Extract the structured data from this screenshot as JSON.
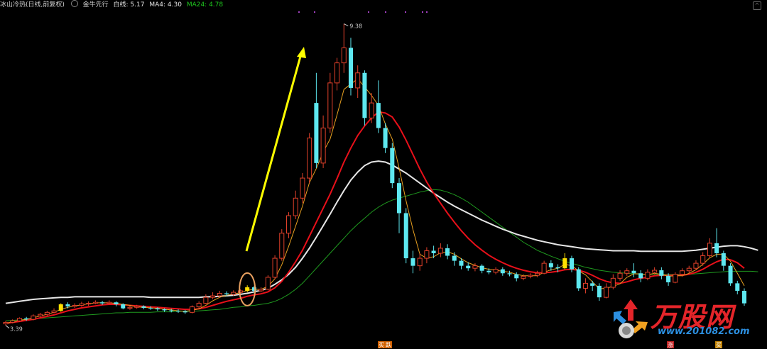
{
  "header": {
    "indicator_name": "冰山冷热(日线,前复权)",
    "study_name": "金牛先行",
    "white_label": "白线: 5.17",
    "ma4_label": "MA4: 4.30",
    "ma24_label": "MA24: 4.78",
    "icon": "gear-icon"
  },
  "watermark": {
    "brand": "万股网",
    "url": "www.201082.com"
  },
  "signals": {
    "buy_label": "买",
    "sell_label": "跌",
    "markers": [
      "买",
      "跌",
      "涨",
      "买"
    ]
  },
  "chart_data": {
    "type": "candlestick",
    "title": "",
    "price_high_label": "9.38",
    "price_low_label": "3.39",
    "ylim": [
      3.2,
      9.6
    ],
    "colors": {
      "up_candle": "#e0402a",
      "down_candle": "#5ee8f0",
      "highlight_candle": "#ffe000",
      "white_line": "#e6e6e6",
      "ma4_line": "#e8a020",
      "ma24_line": "#1f9a1f",
      "red_ma": "#e8101a",
      "arrow": "#ffff00",
      "circle": "#e8a060"
    },
    "candles": [
      [
        3.39,
        3.42,
        3.36,
        3.45
      ],
      [
        3.42,
        3.45,
        3.4,
        3.48
      ],
      [
        3.45,
        3.5,
        3.43,
        3.52
      ],
      [
        3.5,
        3.48,
        3.45,
        3.53
      ],
      [
        3.48,
        3.55,
        3.46,
        3.58
      ],
      [
        3.55,
        3.58,
        3.52,
        3.61
      ],
      [
        3.58,
        3.62,
        3.55,
        3.65
      ],
      [
        3.62,
        3.65,
        3.6,
        3.7
      ],
      [
        3.65,
        3.78,
        3.63,
        3.8
      ],
      [
        3.78,
        3.74,
        3.7,
        3.82
      ],
      [
        3.74,
        3.76,
        3.71,
        3.8
      ],
      [
        3.76,
        3.79,
        3.73,
        3.83
      ],
      [
        3.79,
        3.8,
        3.75,
        3.84
      ],
      [
        3.8,
        3.82,
        3.78,
        3.86
      ],
      [
        3.82,
        3.8,
        3.77,
        3.85
      ],
      [
        3.8,
        3.82,
        3.78,
        3.86
      ],
      [
        3.82,
        3.78,
        3.74,
        3.84
      ],
      [
        3.78,
        3.7,
        3.68,
        3.8
      ],
      [
        3.7,
        3.72,
        3.67,
        3.75
      ],
      [
        3.72,
        3.74,
        3.69,
        3.77
      ],
      [
        3.74,
        3.71,
        3.68,
        3.76
      ],
      [
        3.71,
        3.7,
        3.67,
        3.74
      ],
      [
        3.7,
        3.68,
        3.65,
        3.72
      ],
      [
        3.68,
        3.66,
        3.63,
        3.7
      ],
      [
        3.66,
        3.65,
        3.62,
        3.69
      ],
      [
        3.65,
        3.64,
        3.61,
        3.68
      ],
      [
        3.64,
        3.62,
        3.59,
        3.67
      ],
      [
        3.62,
        3.73,
        3.6,
        3.76
      ],
      [
        3.73,
        3.8,
        3.7,
        3.84
      ],
      [
        3.8,
        3.92,
        3.78,
        3.98
      ],
      [
        3.92,
        3.95,
        3.88,
        4.02
      ],
      [
        3.95,
        4.0,
        3.92,
        4.05
      ],
      [
        4.0,
        3.98,
        3.94,
        4.04
      ],
      [
        3.98,
        4.02,
        3.95,
        4.06
      ],
      [
        4.02,
        4.05,
        3.99,
        4.08
      ],
      [
        4.05,
        4.12,
        4.02,
        4.16
      ],
      [
        4.12,
        4.05,
        4.0,
        4.15
      ],
      [
        4.05,
        4.08,
        4.02,
        4.12
      ],
      [
        4.08,
        4.32,
        4.06,
        4.36
      ],
      [
        4.32,
        4.7,
        4.28,
        4.76
      ],
      [
        4.7,
        5.2,
        4.65,
        5.28
      ],
      [
        5.2,
        5.55,
        5.1,
        5.62
      ],
      [
        5.55,
        5.9,
        5.48,
        6.05
      ],
      [
        5.9,
        6.3,
        5.8,
        6.4
      ],
      [
        6.3,
        7.1,
        6.2,
        7.2
      ],
      [
        7.8,
        6.6,
        6.5,
        8.4
      ],
      [
        6.6,
        7.3,
        6.5,
        7.55
      ],
      [
        7.3,
        8.2,
        7.2,
        8.4
      ],
      [
        8.2,
        8.6,
        8.05,
        8.7
      ],
      [
        8.6,
        8.9,
        8.4,
        9.38
      ],
      [
        8.9,
        8.1,
        7.95,
        9.1
      ],
      [
        8.1,
        8.4,
        7.9,
        8.55
      ],
      [
        8.4,
        7.5,
        7.35,
        8.45
      ],
      [
        7.5,
        7.8,
        7.4,
        8.0
      ],
      [
        7.8,
        7.3,
        7.2,
        8.25
      ],
      [
        7.3,
        6.9,
        6.8,
        7.4
      ],
      [
        6.9,
        6.2,
        6.1,
        7.0
      ],
      [
        6.2,
        5.6,
        5.2,
        6.3
      ],
      [
        5.6,
        4.7,
        4.6,
        5.7
      ],
      [
        4.7,
        4.55,
        4.4,
        4.85
      ],
      [
        4.55,
        4.7,
        4.45,
        4.8
      ],
      [
        4.7,
        4.85,
        4.6,
        4.92
      ],
      [
        4.85,
        4.8,
        4.7,
        4.95
      ],
      [
        4.8,
        4.9,
        4.72,
        5.0
      ],
      [
        4.9,
        4.75,
        4.68,
        4.98
      ],
      [
        4.75,
        4.65,
        4.55,
        4.82
      ],
      [
        4.65,
        4.55,
        4.48,
        4.7
      ],
      [
        4.55,
        4.5,
        4.45,
        4.62
      ],
      [
        4.5,
        4.55,
        4.44,
        4.6
      ],
      [
        4.55,
        4.45,
        4.4,
        4.58
      ],
      [
        4.45,
        4.42,
        4.38,
        4.5
      ],
      [
        4.42,
        4.48,
        4.38,
        4.52
      ],
      [
        4.48,
        4.4,
        4.35,
        4.52
      ],
      [
        4.4,
        4.38,
        4.34,
        4.45
      ],
      [
        4.38,
        4.3,
        4.24,
        4.42
      ],
      [
        4.3,
        4.34,
        4.26,
        4.38
      ],
      [
        4.34,
        4.36,
        4.3,
        4.4
      ],
      [
        4.36,
        4.4,
        4.32,
        4.45
      ],
      [
        4.4,
        4.6,
        4.38,
        4.65
      ],
      [
        4.6,
        4.52,
        4.45,
        4.66
      ],
      [
        4.52,
        4.5,
        4.42,
        4.58
      ],
      [
        4.5,
        4.7,
        4.48,
        4.8
      ],
      [
        4.7,
        4.48,
        4.42,
        4.75
      ],
      [
        4.48,
        4.1,
        4.05,
        4.52
      ],
      [
        4.1,
        4.2,
        4.0,
        4.3
      ],
      [
        4.2,
        4.15,
        4.05,
        4.25
      ],
      [
        4.15,
        3.92,
        3.85,
        4.2
      ],
      [
        3.92,
        4.12,
        3.9,
        4.2
      ],
      [
        4.12,
        4.3,
        4.08,
        4.38
      ],
      [
        4.3,
        4.4,
        4.25,
        4.46
      ],
      [
        4.4,
        4.45,
        4.35,
        4.5
      ],
      [
        4.45,
        4.4,
        4.32,
        4.6
      ],
      [
        4.4,
        4.3,
        4.22,
        4.46
      ],
      [
        4.3,
        4.42,
        4.26,
        4.48
      ],
      [
        4.42,
        4.46,
        4.38,
        4.52
      ],
      [
        4.46,
        4.35,
        4.28,
        4.52
      ],
      [
        4.35,
        4.22,
        4.15,
        4.4
      ],
      [
        4.22,
        4.38,
        4.2,
        4.42
      ],
      [
        4.38,
        4.45,
        4.33,
        4.5
      ],
      [
        4.45,
        4.5,
        4.4,
        4.55
      ],
      [
        4.5,
        4.6,
        4.46,
        4.66
      ],
      [
        4.6,
        4.75,
        4.55,
        4.82
      ],
      [
        4.75,
        5.0,
        4.7,
        5.1
      ],
      [
        5.0,
        4.8,
        4.72,
        5.3
      ],
      [
        4.8,
        4.55,
        4.45,
        4.85
      ],
      [
        4.55,
        4.2,
        4.15,
        4.6
      ],
      [
        4.2,
        4.05,
        3.98,
        4.25
      ],
      [
        4.05,
        3.8,
        3.75,
        4.1
      ]
    ],
    "highlight_indices": [
      8,
      35,
      81
    ],
    "white_line": [
      3.8,
      3.82,
      3.84,
      3.86,
      3.88,
      3.89,
      3.9,
      3.91,
      3.92,
      3.92,
      3.93,
      3.93,
      3.93,
      3.93,
      3.93,
      3.93,
      3.93,
      3.93,
      3.93,
      3.93,
      3.93,
      3.92,
      3.92,
      3.92,
      3.92,
      3.92,
      3.92,
      3.92,
      3.92,
      3.93,
      3.93,
      3.94,
      3.95,
      3.96,
      3.98,
      4.0,
      4.03,
      4.06,
      4.1,
      4.18,
      4.27,
      4.38,
      4.52,
      4.7,
      4.9,
      5.12,
      5.35,
      5.58,
      5.82,
      6.05,
      6.26,
      6.42,
      6.55,
      6.62,
      6.64,
      6.62,
      6.56,
      6.48,
      6.4,
      6.3,
      6.2,
      6.1,
      6.0,
      5.91,
      5.82,
      5.74,
      5.67,
      5.6,
      5.53,
      5.46,
      5.4,
      5.34,
      5.28,
      5.23,
      5.18,
      5.14,
      5.1,
      5.06,
      5.03,
      5.0,
      4.97,
      4.95,
      4.93,
      4.91,
      4.89,
      4.88,
      4.87,
      4.86,
      4.85,
      4.85,
      4.85,
      4.85,
      4.84,
      4.84,
      4.84,
      4.84,
      4.84,
      4.84,
      4.84,
      4.85,
      4.86,
      4.88,
      4.9,
      4.92,
      4.94,
      4.95,
      4.95,
      4.93,
      4.9,
      4.86
    ],
    "ma4": [
      3.4,
      3.43,
      3.46,
      3.48,
      3.51,
      3.55,
      3.58,
      3.62,
      3.68,
      3.72,
      3.75,
      3.77,
      3.79,
      3.81,
      3.81,
      3.81,
      3.8,
      3.78,
      3.76,
      3.73,
      3.72,
      3.71,
      3.7,
      3.68,
      3.67,
      3.65,
      3.64,
      3.66,
      3.69,
      3.76,
      3.85,
      3.92,
      3.96,
      3.99,
      4.01,
      4.06,
      4.08,
      4.08,
      4.14,
      4.29,
      4.57,
      4.94,
      5.34,
      5.74,
      6.21,
      6.49,
      6.82,
      7.08,
      7.56,
      8.07,
      8.18,
      8.28,
      8.12,
      7.95,
      7.75,
      7.38,
      7.08,
      6.5,
      5.85,
      5.27,
      4.78,
      4.7,
      4.73,
      4.81,
      4.83,
      4.78,
      4.69,
      4.61,
      4.56,
      4.51,
      4.48,
      4.46,
      4.44,
      4.42,
      4.38,
      4.35,
      4.35,
      4.35,
      4.42,
      4.47,
      4.5,
      4.58,
      4.55,
      4.45,
      4.37,
      4.23,
      4.09,
      4.1,
      4.14,
      4.19,
      4.32,
      4.39,
      4.39,
      4.37,
      4.4,
      4.38,
      4.34,
      4.35,
      4.35,
      4.4,
      4.47,
      4.58,
      4.71,
      4.78,
      4.78,
      4.64,
      4.4,
      4.15
    ],
    "ma24": [
      3.45,
      3.46,
      3.47,
      3.48,
      3.49,
      3.5,
      3.51,
      3.52,
      3.53,
      3.54,
      3.55,
      3.56,
      3.57,
      3.58,
      3.59,
      3.6,
      3.61,
      3.61,
      3.62,
      3.62,
      3.62,
      3.62,
      3.63,
      3.63,
      3.63,
      3.64,
      3.64,
      3.64,
      3.65,
      3.66,
      3.67,
      3.68,
      3.7,
      3.72,
      3.73,
      3.75,
      3.76,
      3.78,
      3.8,
      3.84,
      3.9,
      3.98,
      4.08,
      4.2,
      4.35,
      4.5,
      4.65,
      4.8,
      4.95,
      5.1,
      5.25,
      5.38,
      5.5,
      5.62,
      5.72,
      5.8,
      5.86,
      5.9,
      5.94,
      5.98,
      6.02,
      6.05,
      6.07,
      6.06,
      6.02,
      5.97,
      5.9,
      5.82,
      5.72,
      5.62,
      5.52,
      5.42,
      5.32,
      5.22,
      5.12,
      5.02,
      4.94,
      4.86,
      4.8,
      4.74,
      4.69,
      4.64,
      4.6,
      4.56,
      4.52,
      4.49,
      4.46,
      4.44,
      4.42,
      4.41,
      4.4,
      4.39,
      4.38,
      4.38,
      4.38,
      4.38,
      4.38,
      4.38,
      4.38,
      4.38,
      4.39,
      4.4,
      4.41,
      4.42,
      4.43,
      4.44,
      4.44,
      4.44,
      4.44,
      4.43
    ],
    "red_ma": [
      3.4,
      3.42,
      3.44,
      3.46,
      3.48,
      3.51,
      3.54,
      3.57,
      3.61,
      3.65,
      3.68,
      3.71,
      3.73,
      3.75,
      3.77,
      3.78,
      3.78,
      3.77,
      3.76,
      3.75,
      3.74,
      3.73,
      3.72,
      3.71,
      3.7,
      3.69,
      3.68,
      3.68,
      3.69,
      3.72,
      3.76,
      3.8,
      3.84,
      3.87,
      3.9,
      3.94,
      3.97,
      3.99,
      4.03,
      4.11,
      4.24,
      4.42,
      4.63,
      4.86,
      5.14,
      5.42,
      5.7,
      5.98,
      6.29,
      6.62,
      6.9,
      7.15,
      7.34,
      7.5,
      7.62,
      7.6,
      7.52,
      7.32,
      7.06,
      6.77,
      6.48,
      6.22,
      6.0,
      5.8,
      5.6,
      5.42,
      5.25,
      5.1,
      4.97,
      4.86,
      4.76,
      4.68,
      4.61,
      4.55,
      4.5,
      4.46,
      4.43,
      4.41,
      4.41,
      4.42,
      4.44,
      4.47,
      4.48,
      4.46,
      4.42,
      4.36,
      4.29,
      4.24,
      4.21,
      4.2,
      4.23,
      4.27,
      4.3,
      4.32,
      4.35,
      4.36,
      4.36,
      4.36,
      4.36,
      4.38,
      4.42,
      4.48,
      4.56,
      4.63,
      4.68,
      4.67,
      4.61,
      4.5
    ]
  }
}
